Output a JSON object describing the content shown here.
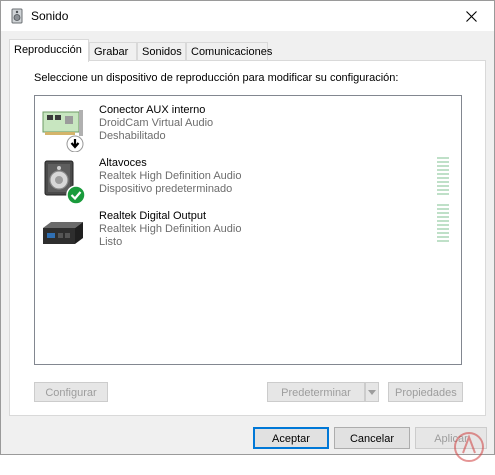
{
  "window": {
    "title": "Sonido",
    "close_icon": "close-icon",
    "title_icon": "speaker-icon"
  },
  "tabs": [
    {
      "label": "Reproducción",
      "active": true
    },
    {
      "label": "Grabar"
    },
    {
      "label": "Sonidos"
    },
    {
      "label": "Comunicaciones"
    }
  ],
  "panel": {
    "instruction": "Seleccione un dispositivo de reproducción para modificar su configuración:"
  },
  "devices": [
    {
      "name": "Conector AUX interno",
      "driver": "DroidCam Virtual Audio",
      "status": "Deshabilitado",
      "icon": "sound-card-disabled-icon"
    },
    {
      "name": "Altavoces",
      "driver": "Realtek High Definition Audio",
      "status": "Dispositivo predeterminado",
      "icon": "speaker-default-icon"
    },
    {
      "name": "Realtek Digital Output",
      "driver": "Realtek High Definition Audio",
      "status": "Listo",
      "icon": "digital-output-icon"
    }
  ],
  "buttons": {
    "configure": "Configurar",
    "set_default": "Predeterminar",
    "properties": "Propiedades",
    "accept": "Aceptar",
    "cancel": "Cancelar",
    "apply": "Aplicar"
  },
  "colors": {
    "accent": "#0078d7",
    "check_green": "#1a9b3c",
    "meter": "#bfe0c8"
  }
}
